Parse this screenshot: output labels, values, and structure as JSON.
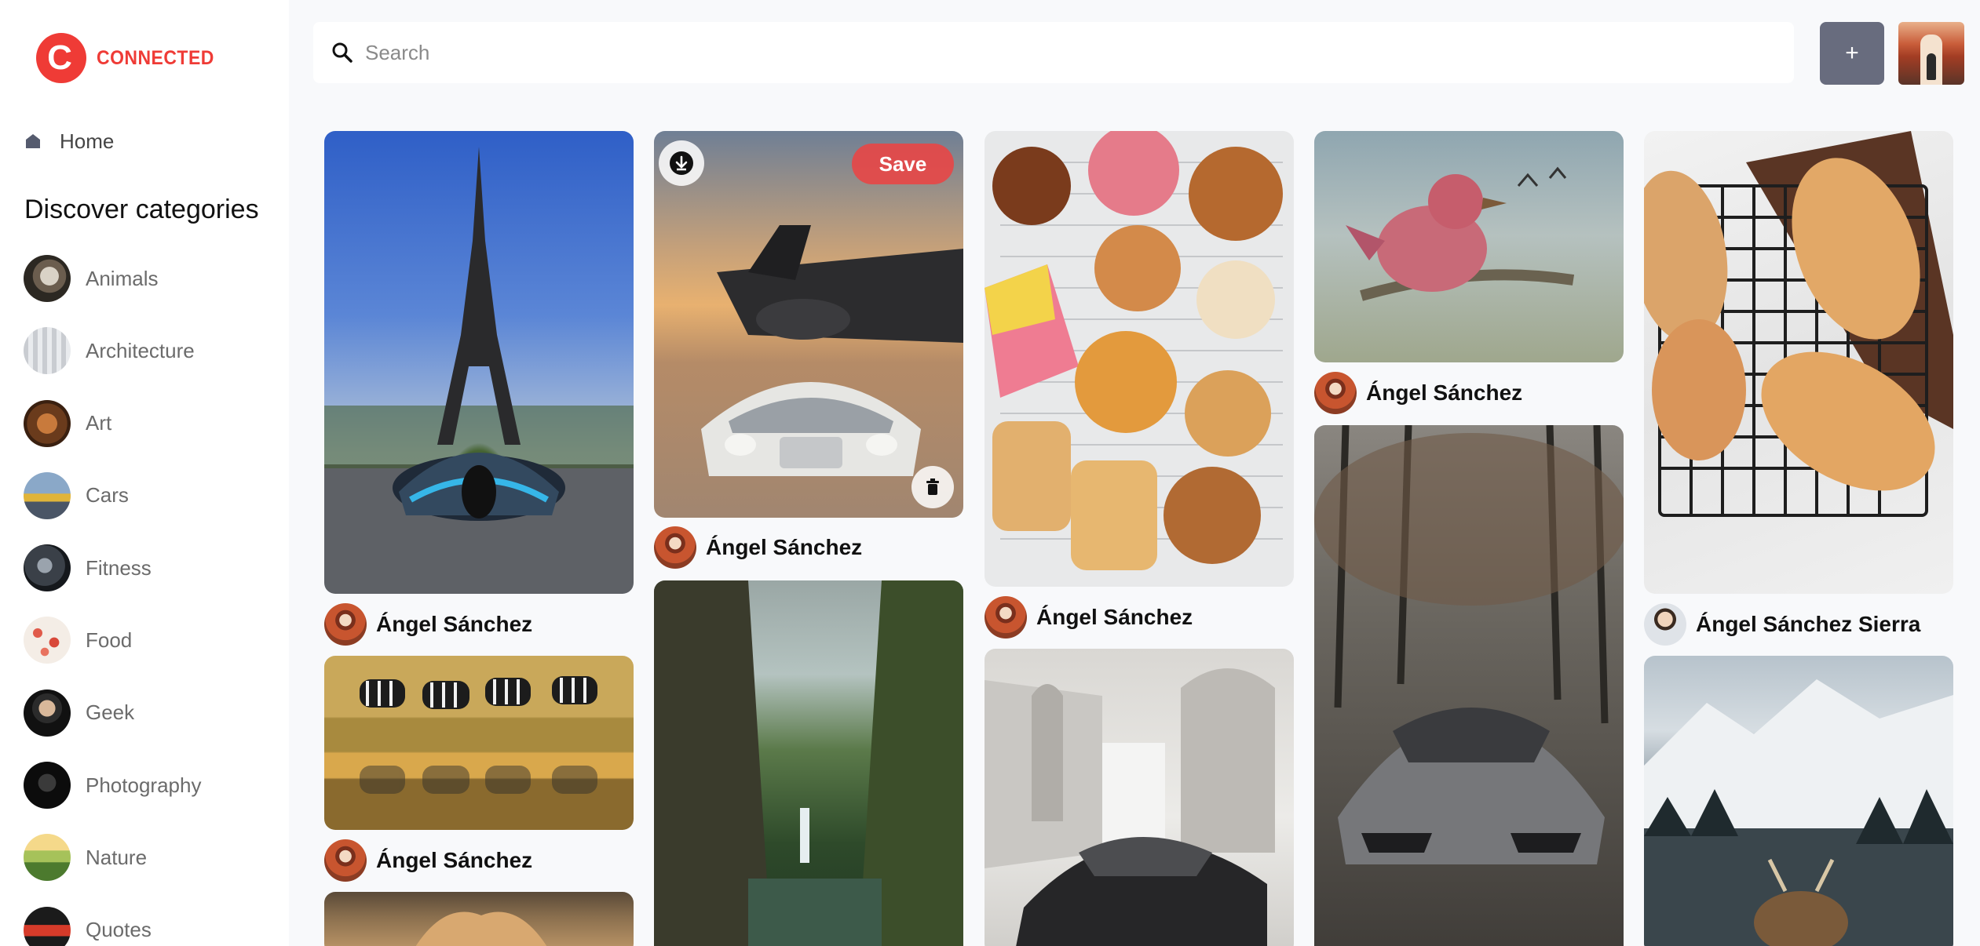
{
  "app": {
    "brand": "CONNECTED",
    "logo_letter": "C"
  },
  "sidebar": {
    "home_label": "Home",
    "categories_heading": "Discover categories",
    "categories": [
      {
        "label": "Animals"
      },
      {
        "label": "Architecture"
      },
      {
        "label": "Art"
      },
      {
        "label": "Cars"
      },
      {
        "label": "Fitness"
      },
      {
        "label": "Food"
      },
      {
        "label": "Geek"
      },
      {
        "label": "Photography"
      },
      {
        "label": "Nature"
      },
      {
        "label": "Quotes"
      }
    ]
  },
  "topbar": {
    "search_placeholder": "Search",
    "add_label": "+"
  },
  "pins": {
    "eiffel_car": {
      "author": "Ángel Sánchez"
    },
    "jet_car": {
      "author": "Ángel Sánchez",
      "save_label": "Save"
    },
    "pastries": {
      "author": "Ángel Sánchez"
    },
    "bird": {
      "author": "Ángel Sánchez"
    },
    "bread": {
      "author": "Ángel Sánchez Sierra"
    },
    "zebras": {
      "author": "Ángel Sánchez"
    }
  },
  "colors": {
    "accent": "#ef3b36",
    "add_button": "#686c7e",
    "background": "#f8f9fb"
  }
}
